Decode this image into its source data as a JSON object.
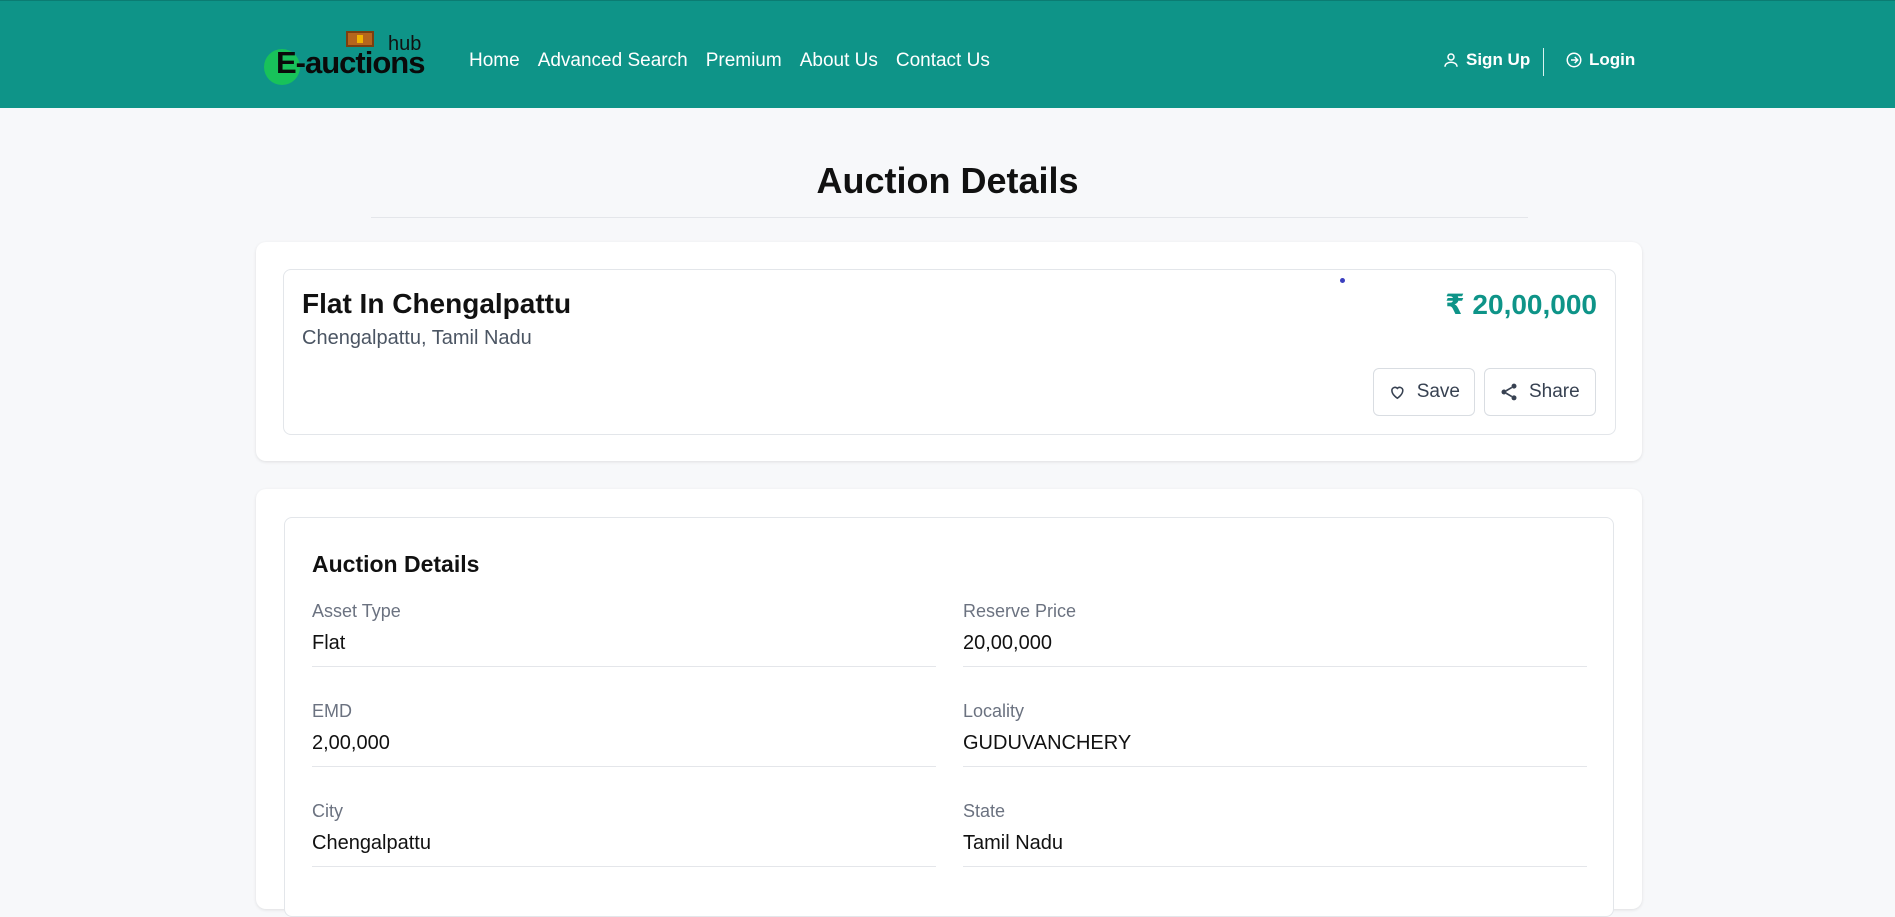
{
  "brand": {
    "logo_word": "E-auctions",
    "logo_sub": "hub"
  },
  "nav": {
    "items": [
      "Home",
      "Advanced Search",
      "Premium",
      "About Us",
      "Contact Us"
    ]
  },
  "auth": {
    "signup_label": "Sign Up",
    "login_label": "Login"
  },
  "page": {
    "title": "Auction Details"
  },
  "listing": {
    "title": "Flat In Chengalpattu",
    "location": "Chengalpattu, Tamil Nadu",
    "price": "₹ 20,00,000",
    "save_label": "Save",
    "share_label": "Share"
  },
  "details": {
    "section_title": "Auction Details",
    "fields": [
      {
        "label": "Asset Type",
        "value": "Flat"
      },
      {
        "label": "Reserve Price",
        "value": "20,00,000"
      },
      {
        "label": "EMD",
        "value": "2,00,000"
      },
      {
        "label": "Locality",
        "value": "GUDUVANCHERY"
      },
      {
        "label": "City",
        "value": "Chengalpattu"
      },
      {
        "label": "State",
        "value": "Tamil Nadu"
      }
    ]
  },
  "colors": {
    "header_bg": "#0e9488",
    "accent": "#0e9488",
    "page_bg": "#f7f8fa"
  },
  "icons": [
    "user-icon",
    "login-icon",
    "heart-icon",
    "share-icon",
    "gavel-icon"
  ]
}
